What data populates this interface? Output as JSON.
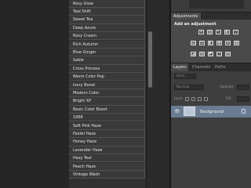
{
  "presets": [
    "Rosy Glow",
    "Teal Shift",
    "Sweet Tea",
    "Deep Azure",
    "Roxy Cream",
    "Rich Autumn",
    "Blue Ginger",
    "Sable",
    "Cross Process",
    "Warm Color Pop",
    "Ivory Boost",
    "Modern Color",
    "Bright XP",
    "Basic Color Boost",
    "1968",
    "Soft Pink Haze",
    "Pastel Haze",
    "Honey Haze",
    "Lavender Haze",
    "Hazy Teal",
    "Peach Haze",
    "Vintage Wash"
  ],
  "adjustments": {
    "tab_label": "Adjustments",
    "heading": "Add an adjustment",
    "row1_icons": [
      "brightness-contrast-icon",
      "levels-icon",
      "curves-icon",
      "exposure-icon",
      "vibrance-icon"
    ],
    "row2_icons": [
      "hue-saturation-icon",
      "color-balance-icon",
      "black-white-icon",
      "photo-filter-icon",
      "channel-mixer-icon",
      "color-lookup-icon"
    ],
    "row3_icons": [
      "invert-icon",
      "posterize-icon",
      "threshold-icon",
      "selective-color-icon",
      "gradient-map-icon"
    ]
  },
  "layers_panel": {
    "tabs": [
      "Layers",
      "Channels",
      "Paths"
    ],
    "kind_filter": "Kind",
    "blend_mode": "Normal",
    "opacity_label": "Opacity:",
    "lock_label": "Lock:",
    "fill_label": "Fill:",
    "layer_name": "Background"
  }
}
